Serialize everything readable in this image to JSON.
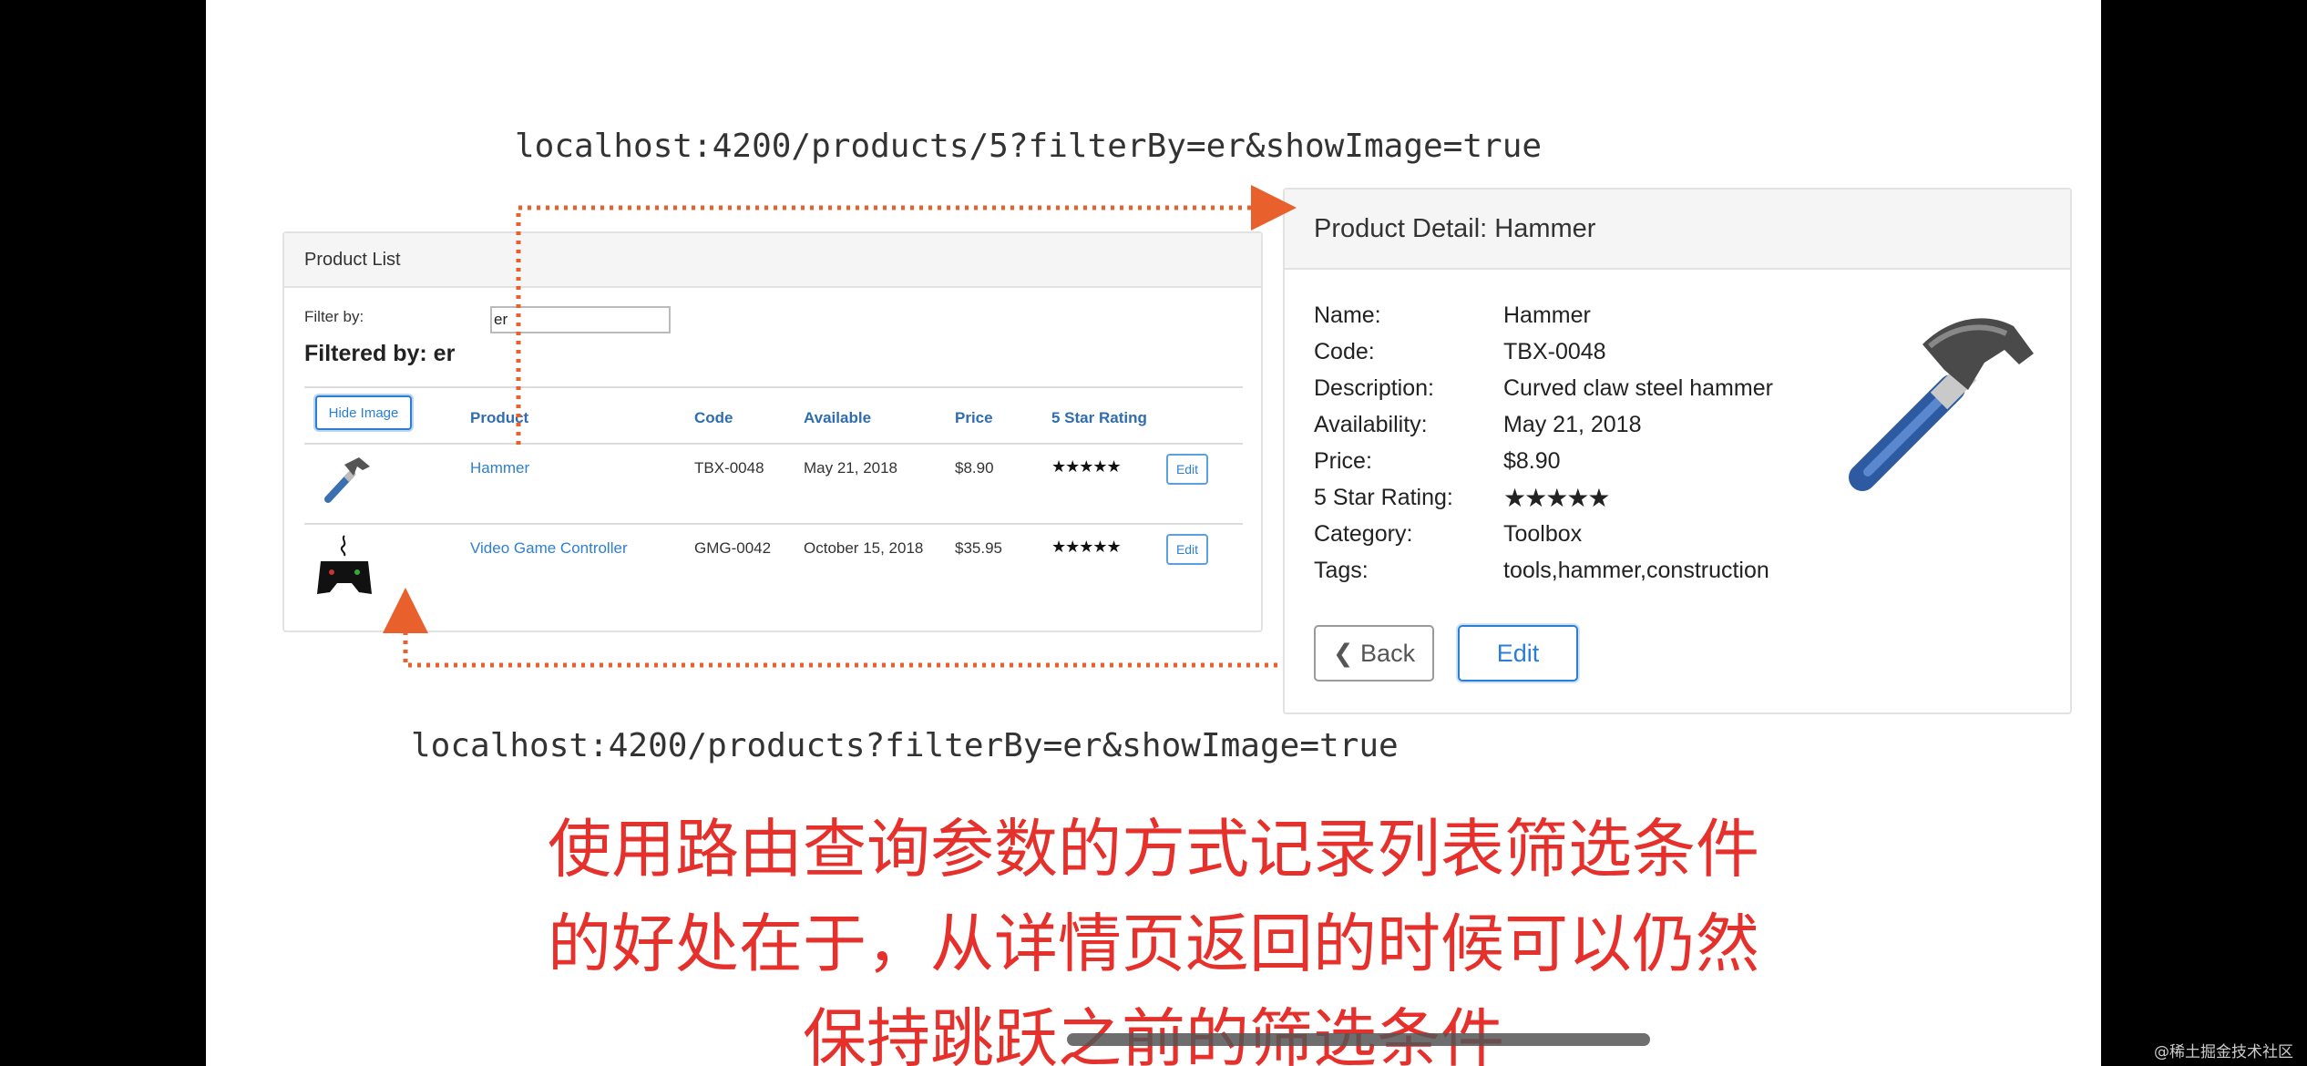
{
  "urls": {
    "detail": "localhost:4200/products/5?filterBy=er&showImage=true",
    "list": "localhost:4200/products?filterBy=er&showImage=true"
  },
  "product_list": {
    "title": "Product List",
    "filter_label": "Filter by:",
    "filter_value": "er",
    "filtered_by": "Filtered by: er",
    "hide_image_label": "Hide Image",
    "columns": [
      "Product",
      "Code",
      "Available",
      "Price",
      "5 Star Rating"
    ],
    "rows": [
      {
        "product": "Hammer",
        "code": "TBX-0048",
        "available": "May 21, 2018",
        "price": "$8.90",
        "rating_stars": "★★★★★",
        "edit": "Edit",
        "image": "hammer-icon"
      },
      {
        "product": "Video Game Controller",
        "code": "GMG-0042",
        "available": "October 15, 2018",
        "price": "$35.95",
        "rating_stars": "★★★★★",
        "edit": "Edit",
        "image": "gamepad-icon"
      }
    ]
  },
  "product_detail": {
    "title": "Product Detail: Hammer",
    "fields": [
      {
        "label": "Name:",
        "value": "Hammer"
      },
      {
        "label": "Code:",
        "value": "TBX-0048"
      },
      {
        "label": "Description:",
        "value": "Curved claw steel hammer"
      },
      {
        "label": "Availability:",
        "value": "May 21, 2018"
      },
      {
        "label": "Price:",
        "value": "$8.90"
      },
      {
        "label": "5 Star Rating:",
        "value": "★★★★★"
      },
      {
        "label": "Category:",
        "value": "Toolbox"
      },
      {
        "label": "Tags:",
        "value": "tools,hammer,construction"
      }
    ],
    "back_label": "Back",
    "edit_label": "Edit"
  },
  "subtitles": [
    "使用路由查询参数的方式记录列表筛选条件",
    "的好处在于，从详情页返回的时候可以仍然",
    "保持跳跃之前的筛选条件"
  ],
  "watermark": "@稀土掘金技术社区",
  "colors": {
    "arrow": "#e8602c",
    "subtitle": "#e5302c",
    "link": "#2f7fcf"
  }
}
